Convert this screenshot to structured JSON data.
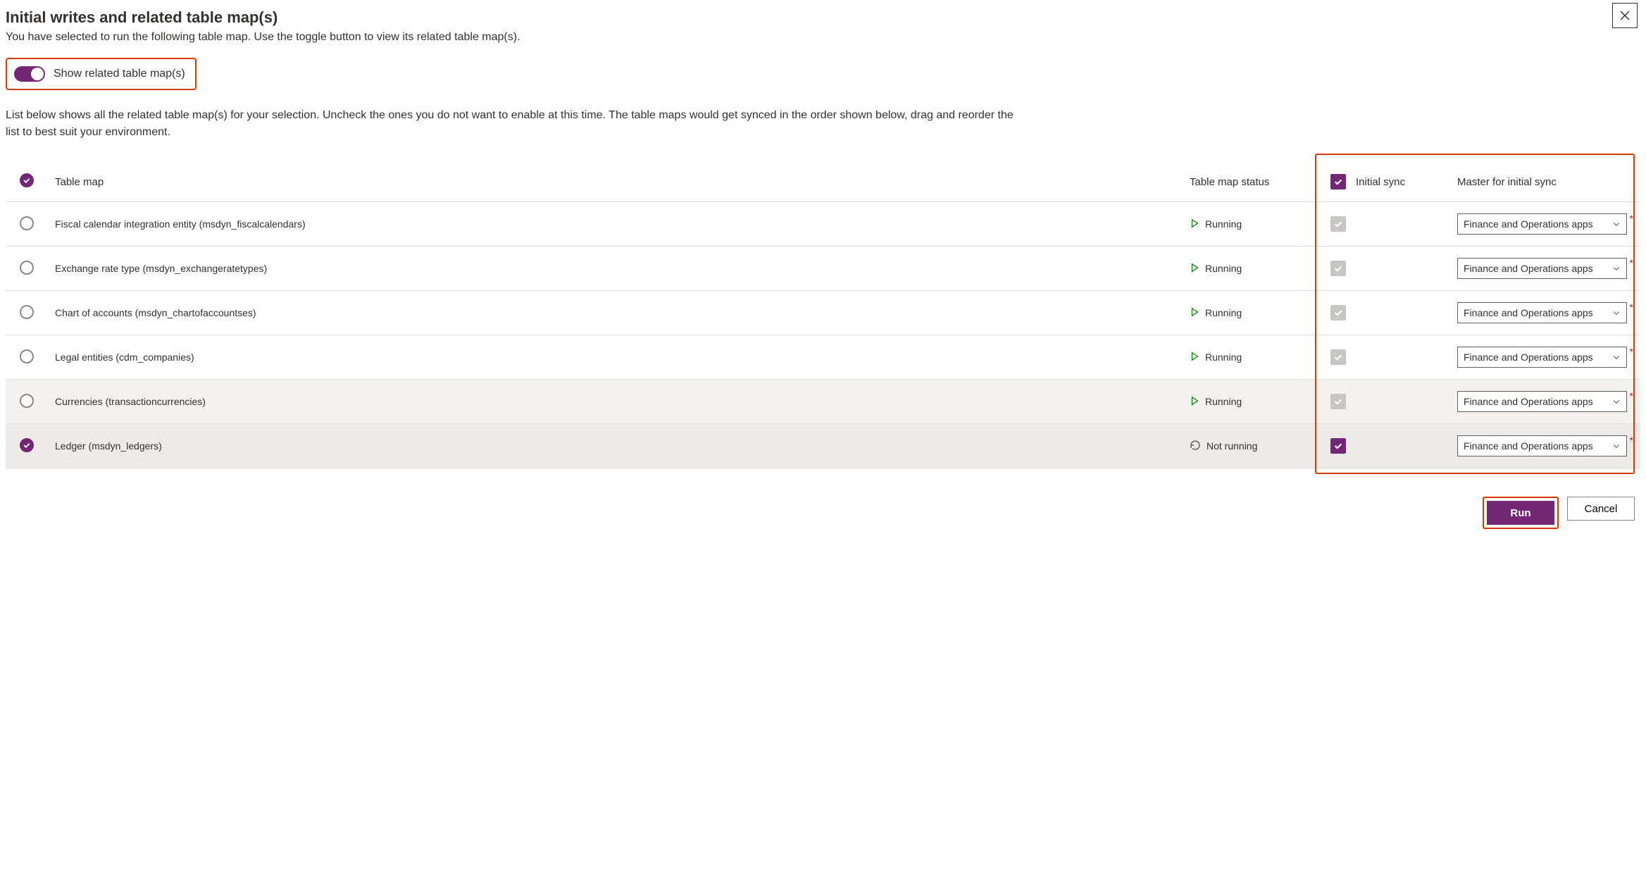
{
  "dialog": {
    "title": "Initial writes and related table map(s)",
    "subtitle": "You have selected to run the following table map. Use the toggle button to view its related table map(s).",
    "toggle_label": "Show related table map(s)",
    "description": "List below shows all the related table map(s) for your selection. Uncheck the ones you do not want to enable at this time. The table maps would get synced in the order shown below, drag and reorder the list to best suit your environment."
  },
  "columns": {
    "name": "Table map",
    "status": "Table map status",
    "initial_sync": "Initial sync",
    "master": "Master for initial sync"
  },
  "status_labels": {
    "running": "Running",
    "not_running": "Not running"
  },
  "master_default": "Finance and Operations apps",
  "rows": [
    {
      "selected": false,
      "name": "Fiscal calendar integration entity (msdyn_fiscalcalendars)",
      "status": "running",
      "sync_disabled": true,
      "master": "Finance and Operations apps"
    },
    {
      "selected": false,
      "name": "Exchange rate type (msdyn_exchangeratetypes)",
      "status": "running",
      "sync_disabled": true,
      "master": "Finance and Operations apps"
    },
    {
      "selected": false,
      "name": "Chart of accounts (msdyn_chartofaccountses)",
      "status": "running",
      "sync_disabled": true,
      "master": "Finance and Operations apps"
    },
    {
      "selected": false,
      "name": "Legal entities (cdm_companies)",
      "status": "running",
      "sync_disabled": true,
      "master": "Finance and Operations apps"
    },
    {
      "selected": false,
      "name": "Currencies (transactioncurrencies)",
      "status": "running",
      "sync_disabled": true,
      "master": "Finance and Operations apps",
      "alt": 1
    },
    {
      "selected": true,
      "name": "Ledger (msdyn_ledgers)",
      "status": "not_running",
      "sync_disabled": false,
      "master": "Finance and Operations apps",
      "alt": 2
    }
  ],
  "buttons": {
    "run": "Run",
    "cancel": "Cancel"
  }
}
